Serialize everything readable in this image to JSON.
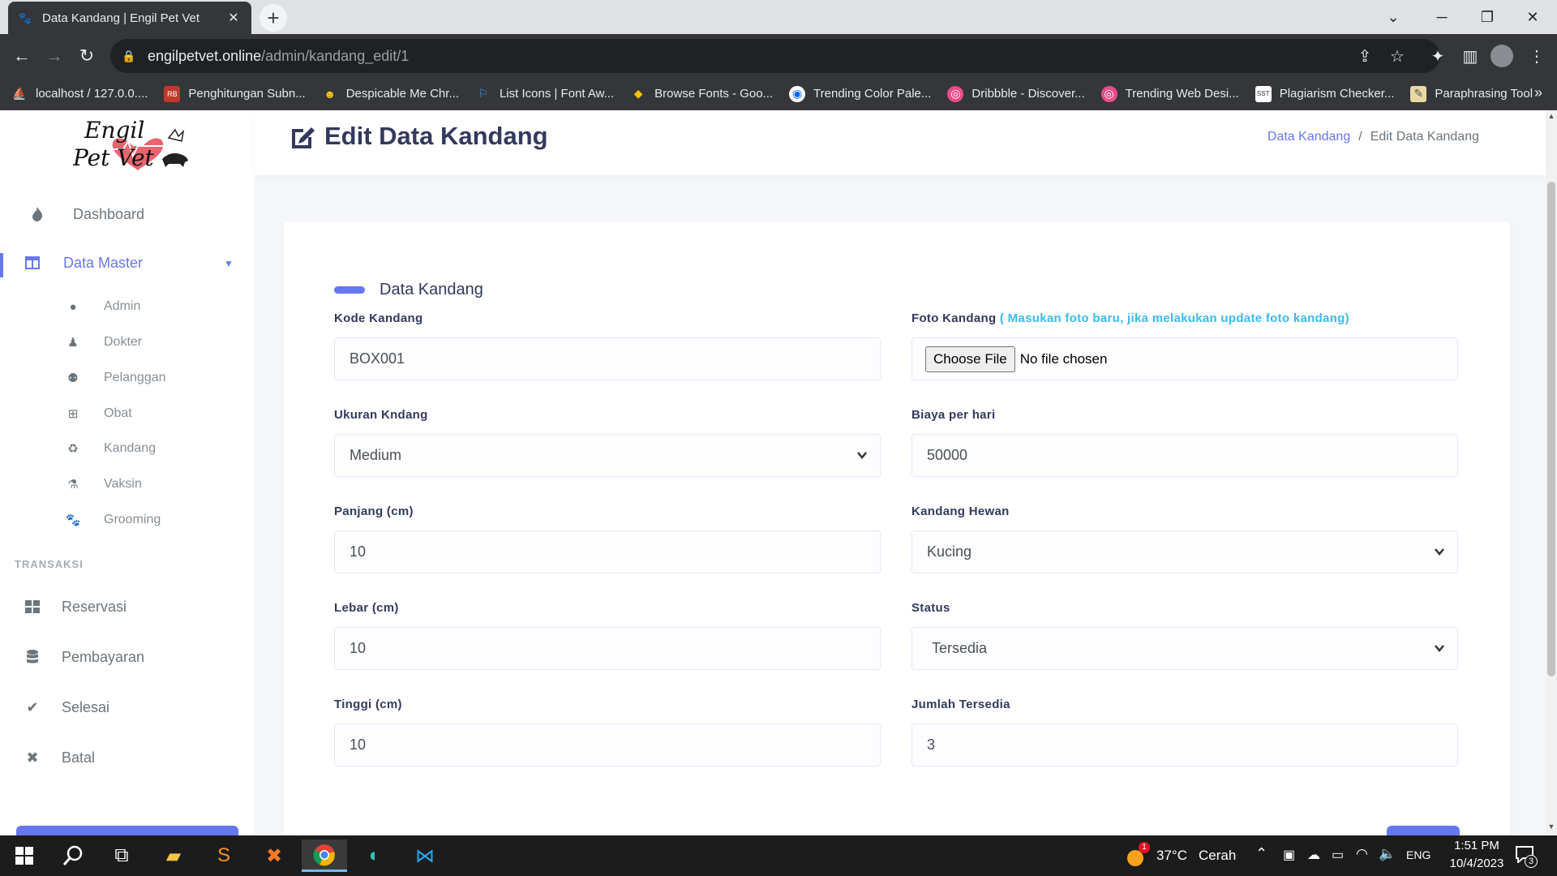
{
  "browser": {
    "tab_title": "Data Kandang | Engil Pet Vet",
    "url_host": "engilpetvet.online",
    "url_path": "/admin/kandang_edit/1",
    "bookmarks": [
      {
        "label": "localhost / 127.0.0....",
        "icon": "phpmyadmin-icon"
      },
      {
        "label": "Penghitungan Subn...",
        "icon": "subnet-icon"
      },
      {
        "label": "Despicable Me Chr...",
        "icon": "despicable-icon"
      },
      {
        "label": "List Icons | Font Aw...",
        "icon": "fontawesome-flag-icon"
      },
      {
        "label": "Browse Fonts - Goo...",
        "icon": "google-fonts-icon"
      },
      {
        "label": "Trending Color Pale...",
        "icon": "coolors-icon"
      },
      {
        "label": "Dribbble - Discover...",
        "icon": "dribbble-icon"
      },
      {
        "label": "Trending Web Desi...",
        "icon": "dribbble-icon"
      },
      {
        "label": "Plagiarism Checker...",
        "icon": "sst-icon"
      },
      {
        "label": "Paraphrasing Tool",
        "icon": "quillbot-icon"
      }
    ]
  },
  "brand": {
    "logo_line1": "Engil",
    "logo_line2": "Pet Vet"
  },
  "sidebar": {
    "dashboard": "Dashboard",
    "data_master": "Data Master",
    "sub_items": [
      "Admin",
      "Dokter",
      "Pelanggan",
      "Obat",
      "Kandang",
      "Vaksin",
      "Grooming"
    ],
    "section_transaksi": "TRANSAKSI",
    "transaksi_items": [
      "Reservasi",
      "Pembayaran",
      "Selesai",
      "Batal"
    ]
  },
  "header": {
    "title": "Edit Data Kandang",
    "breadcrumb_link": "Data Kandang",
    "breadcrumb_sep": "/",
    "breadcrumb_current": "Edit Data Kandang"
  },
  "form": {
    "section_title": "Data Kandang",
    "kode": {
      "label": "Kode Kandang",
      "value": "BOX001"
    },
    "foto": {
      "label": "Foto Kandang",
      "hint": "( Masukan foto baru, jika melakukan update foto kandang)",
      "button": "Choose File",
      "status": "No file chosen"
    },
    "ukuran": {
      "label": "Ukuran Kndang",
      "value": "Medium"
    },
    "biaya": {
      "label": "Biaya per hari",
      "value": "50000"
    },
    "panjang": {
      "label": "Panjang (cm)",
      "value": "10"
    },
    "hewan": {
      "label": "Kandang Hewan",
      "value": "Kucing"
    },
    "lebar": {
      "label": "Lebar (cm)",
      "value": "10"
    },
    "status": {
      "label": "Status",
      "value": "Tersedia"
    },
    "tinggi": {
      "label": "Tinggi (cm)",
      "value": "10"
    },
    "jumlah": {
      "label": "Jumlah Tersedia",
      "value": "3"
    }
  },
  "taskbar": {
    "weather_temp": "37°C",
    "weather_text": "Cerah",
    "weather_badge": "1",
    "language": "ENG",
    "time": "1:51 PM",
    "date": "10/4/2023",
    "notification_count": "3"
  },
  "colors": {
    "accent": "#6777ef",
    "hint": "#3abaf4",
    "title": "#34395e"
  }
}
